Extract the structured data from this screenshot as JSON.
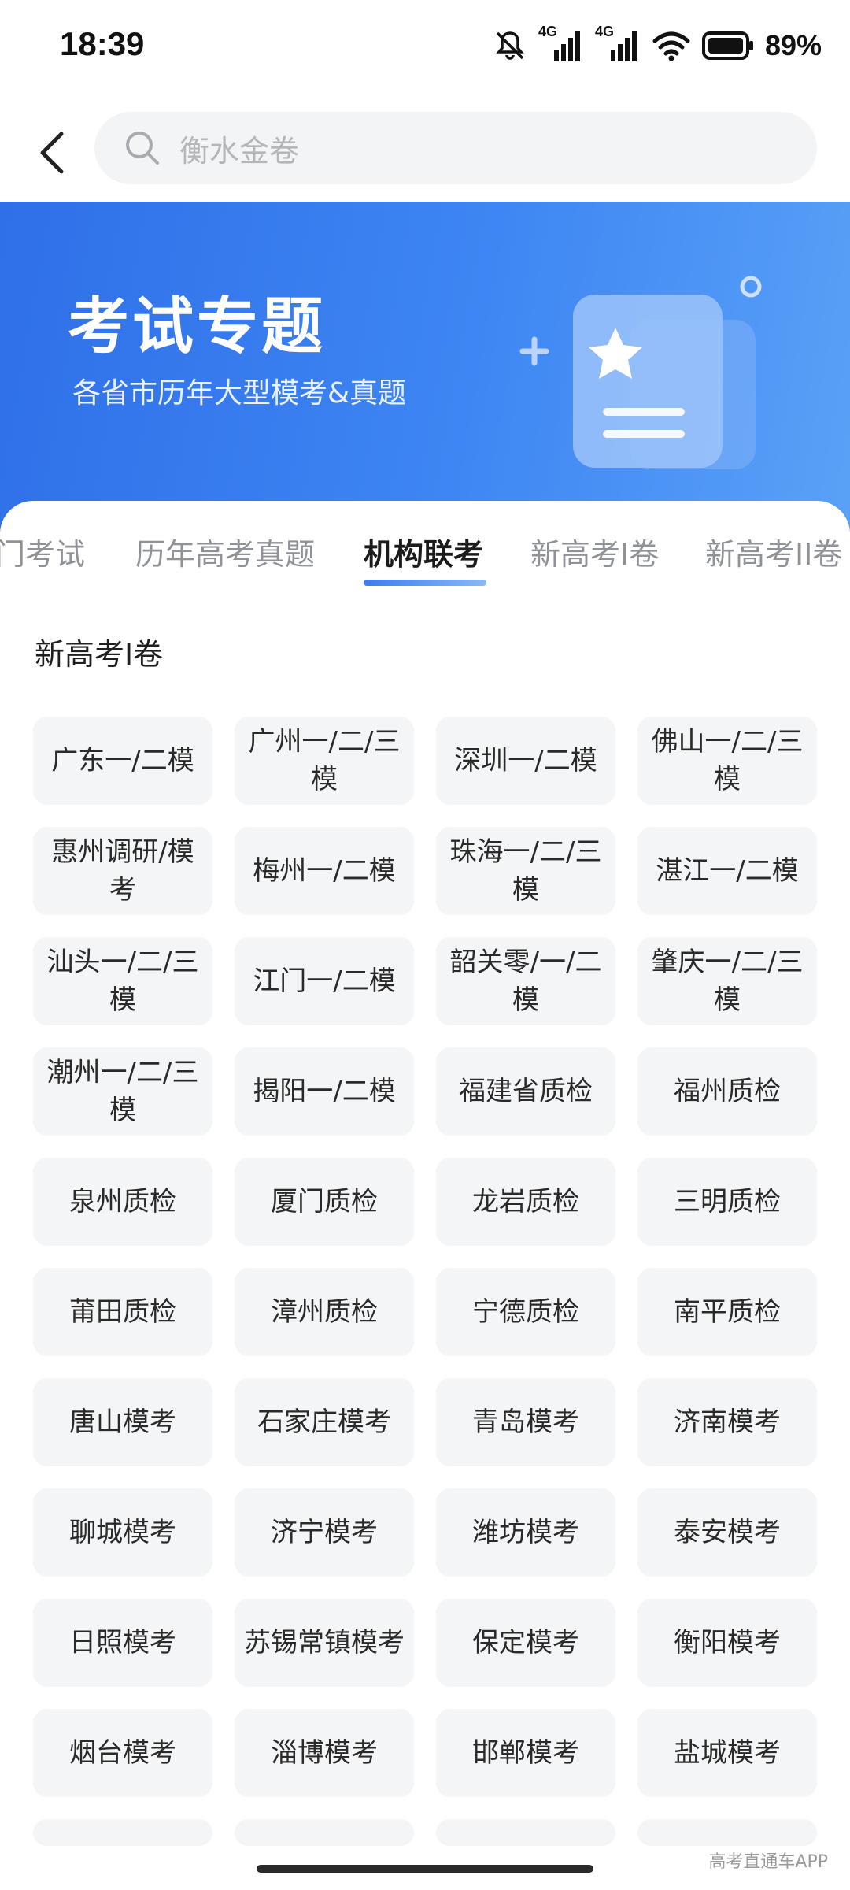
{
  "status_bar": {
    "time": "18:39",
    "battery": "89%",
    "network_1": "4G",
    "network_2": "4G",
    "icons": [
      "bell-mute-icon",
      "signal-icon",
      "signal-icon",
      "wifi-icon",
      "battery-icon"
    ]
  },
  "search": {
    "placeholder": "衡水金卷"
  },
  "banner": {
    "title": "考试专题",
    "subtitle": "各省市历年大型模考&真题"
  },
  "tabs": [
    {
      "label": "门考试",
      "active": false
    },
    {
      "label": "历年高考真题",
      "active": false
    },
    {
      "label": "机构联考",
      "active": true
    },
    {
      "label": "新高考I卷",
      "active": false
    },
    {
      "label": "新高考II卷",
      "active": false
    }
  ],
  "section": {
    "title": "新高考I卷"
  },
  "items": [
    "广东一/二模",
    "广州一/二/三模",
    "深圳一/二模",
    "佛山一/二/三模",
    "惠州调研/模考",
    "梅州一/二模",
    "珠海一/二/三模",
    "湛江一/二模",
    "汕头一/二/三模",
    "江门一/二模",
    "韶关零/一/二模",
    "肇庆一/二/三模",
    "潮州一/二/三模",
    "揭阳一/二模",
    "福建省质检",
    "福州质检",
    "泉州质检",
    "厦门质检",
    "龙岩质检",
    "三明质检",
    "莆田质检",
    "漳州质检",
    "宁德质检",
    "南平质检",
    "唐山模考",
    "石家庄模考",
    "青岛模考",
    "济南模考",
    "聊城模考",
    "济宁模考",
    "潍坊模考",
    "泰安模考",
    "日照模考",
    "苏锡常镇模考",
    "保定模考",
    "衡阳模考",
    "烟台模考",
    "淄博模考",
    "邯郸模考",
    "盐城模考"
  ],
  "watermark": "高考直通车APP",
  "colors": {
    "accent": "#3a7ef0",
    "chip_bg": "#f4f5f7"
  }
}
